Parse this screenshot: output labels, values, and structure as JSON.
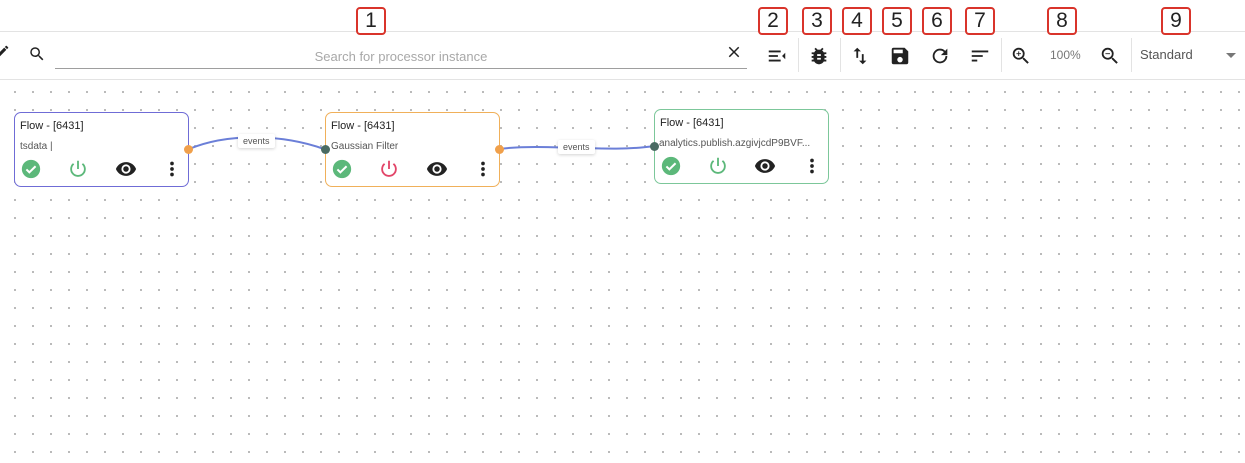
{
  "toolbar": {
    "search": {
      "placeholder": "Search for processor instance",
      "value": ""
    },
    "zoom_level": "100%",
    "mode": {
      "selected": "Standard"
    },
    "icons": [
      "pencil-icon",
      "search-icon",
      "close-icon",
      "collapse-list-icon",
      "debug-bug-icon",
      "swap-vert-icon",
      "save-icon",
      "refresh-icon",
      "sort-icon",
      "zoom-in-icon",
      "zoom-out-icon",
      "chevron-down-icon"
    ]
  },
  "callouts": [
    "1",
    "2",
    "3",
    "4",
    "5",
    "6",
    "7",
    "8",
    "9"
  ],
  "nodes": [
    {
      "title": "Flow - [6431]",
      "subtitle": "tsdata |",
      "status": "ok",
      "power": "on",
      "border_color": "#6f6cd6"
    },
    {
      "title": "Flow - [6431]",
      "subtitle": "Gaussian Filter",
      "status": "ok",
      "power": "off",
      "border_color": "#f0b05a"
    },
    {
      "title": "Flow - [6431]",
      "subtitle": "analytics.publish.azgivjcdP9BVF...",
      "status": "ok",
      "power": "on",
      "border_color": "#7cc79a"
    }
  ],
  "edges": [
    {
      "label": "events"
    },
    {
      "label": "events"
    }
  ],
  "colors": {
    "status_ok": "#5cb87a",
    "power_on": "#5cb87a",
    "power_off": "#e24568",
    "edge": "#6b7fd8",
    "port_out": "#f0a04b",
    "port_in": "#4a6b63",
    "callout_border": "#d9342b"
  }
}
